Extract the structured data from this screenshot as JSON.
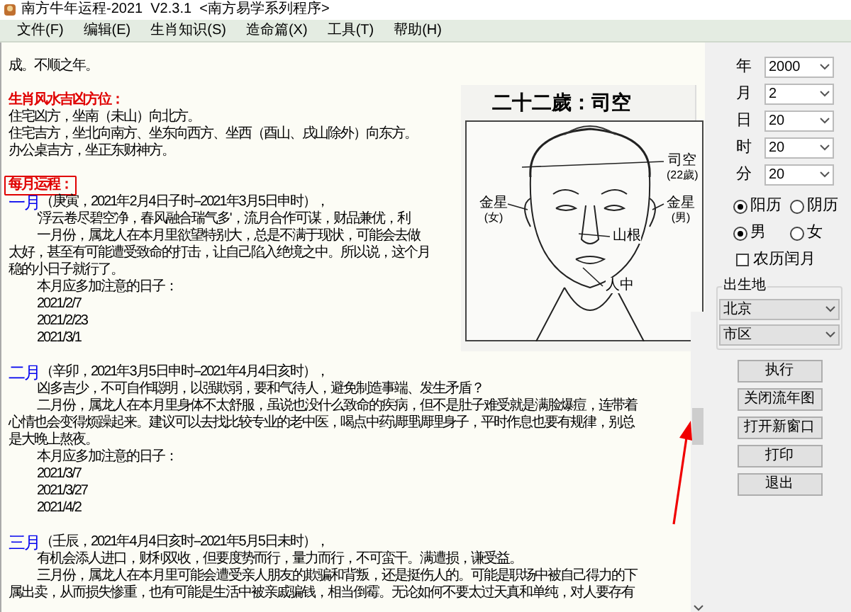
{
  "window": {
    "title": "南方牛年运程-2021  V2.3.1  <南方易学系列程序>"
  },
  "menu": [
    "文件(F)",
    "编辑(E)",
    "生肖知识(S)",
    "造命篇(X)",
    "工具(T)",
    "帮助(H)"
  ],
  "content": [
    {
      "kind": "text",
      "text": "成。不顺之年。"
    },
    {
      "kind": "blank"
    },
    {
      "kind": "heading",
      "text": "生肖风水吉凶方位：",
      "boxed": false
    },
    {
      "kind": "text",
      "text": "住宅凶方，坐南（未山）向北方。"
    },
    {
      "kind": "text",
      "text": "住宅吉方，坐北向南方、坐东向西方、坐西（酉山、戌山除外）向东方。"
    },
    {
      "kind": "text",
      "text": "办公桌吉方，坐正东财神方。"
    },
    {
      "kind": "blank"
    },
    {
      "kind": "heading",
      "text": "每月运程：",
      "boxed": true
    },
    {
      "kind": "month",
      "month": "一月",
      "text": "（庚寅，2021年2月4日子时--2021年3月5日申时），"
    },
    {
      "kind": "indent",
      "text": "'浮云卷尽碧空净，春风融合瑞气多'，流月合作可谋，财品兼优，利"
    },
    {
      "kind": "indent",
      "text": "一月份，属龙人在本月里欲望特别大，总是不满于现状，可能会去做"
    },
    {
      "kind": "text",
      "text": "太好，甚至有可能遭受致命的打击，让自己陷入绝境之中。所以说，这个月"
    },
    {
      "kind": "text",
      "text": "稳的小日子就行了。"
    },
    {
      "kind": "indent",
      "text": "本月应多加注意的日子："
    },
    {
      "kind": "indent",
      "text": "2021/2/7"
    },
    {
      "kind": "indent",
      "text": "2021/2/23"
    },
    {
      "kind": "indent",
      "text": "2021/3/1"
    },
    {
      "kind": "blank"
    },
    {
      "kind": "month",
      "month": "二月",
      "text": "（辛卯，2021年3月5日申时--2021年4月4日亥时），"
    },
    {
      "kind": "indent",
      "text": "凶多吉少，不可自作聪明，以强欺弱，要和气待人，避免制造事端、发生矛盾？"
    },
    {
      "kind": "indent",
      "text": "二月份，属龙人在本月里身体不太舒服，虽说也没什么致命的疾病，但不是肚子难受就是满脸爆痘，连带着"
    },
    {
      "kind": "text",
      "text": "心情也会变得烦躁起来。建议可以去找比较专业的老中医，喝点中药调理调理身子，平时作息也要有规律，别总"
    },
    {
      "kind": "text",
      "text": "是大晚上熬夜。"
    },
    {
      "kind": "indent",
      "text": "本月应多加注意的日子："
    },
    {
      "kind": "indent",
      "text": "2021/3/7"
    },
    {
      "kind": "indent",
      "text": "2021/3/27"
    },
    {
      "kind": "indent",
      "text": "2021/4/2"
    },
    {
      "kind": "blank"
    },
    {
      "kind": "month",
      "month": "三月",
      "text": "（壬辰，2021年4月4日亥时--2021年5月5日未时），"
    },
    {
      "kind": "indent",
      "text": "有机会添人进口，财利双收，但要度势而行，量力而行，不可蛮干。满遭损，谦受益。"
    },
    {
      "kind": "indent",
      "text": "三月份，属龙人在本月里可能会遭受亲人朋友的欺骗和背叛，还是挺伤人的。可能是职场中被自己得力的下"
    },
    {
      "kind": "text",
      "text": "属出卖，从而损失惨重，也有可能是生活中被亲戚骗钱，相当倒霉。无论如何不要太过天真和单纯，对人要存有"
    }
  ],
  "illustration": {
    "title": "二十二歲：司空",
    "labels": [
      {
        "text": "司空",
        "sub": "(22歲)"
      },
      {
        "text": "金星",
        "sub": "(女)"
      },
      {
        "text": "金星",
        "sub": "(男)"
      },
      {
        "text": "山根"
      },
      {
        "text": "人中"
      }
    ]
  },
  "fields": [
    {
      "label": "年",
      "value": "2000"
    },
    {
      "label": "月",
      "value": "2"
    },
    {
      "label": "日",
      "value": "20"
    },
    {
      "label": "时",
      "value": "20"
    },
    {
      "label": "分",
      "value": "20"
    }
  ],
  "calendar": [
    {
      "label": "阳历",
      "selected": true
    },
    {
      "label": "阴历",
      "selected": false
    }
  ],
  "gender": [
    {
      "label": "男",
      "selected": true
    },
    {
      "label": "女",
      "selected": false
    }
  ],
  "leap_month": {
    "label": "农历闰月",
    "checked": false
  },
  "birthplace": {
    "title": "出生地",
    "province": "北京",
    "district": "市区"
  },
  "buttons": [
    "执行",
    "关闭流年图",
    "打开新窗口",
    "打印",
    "退出"
  ]
}
